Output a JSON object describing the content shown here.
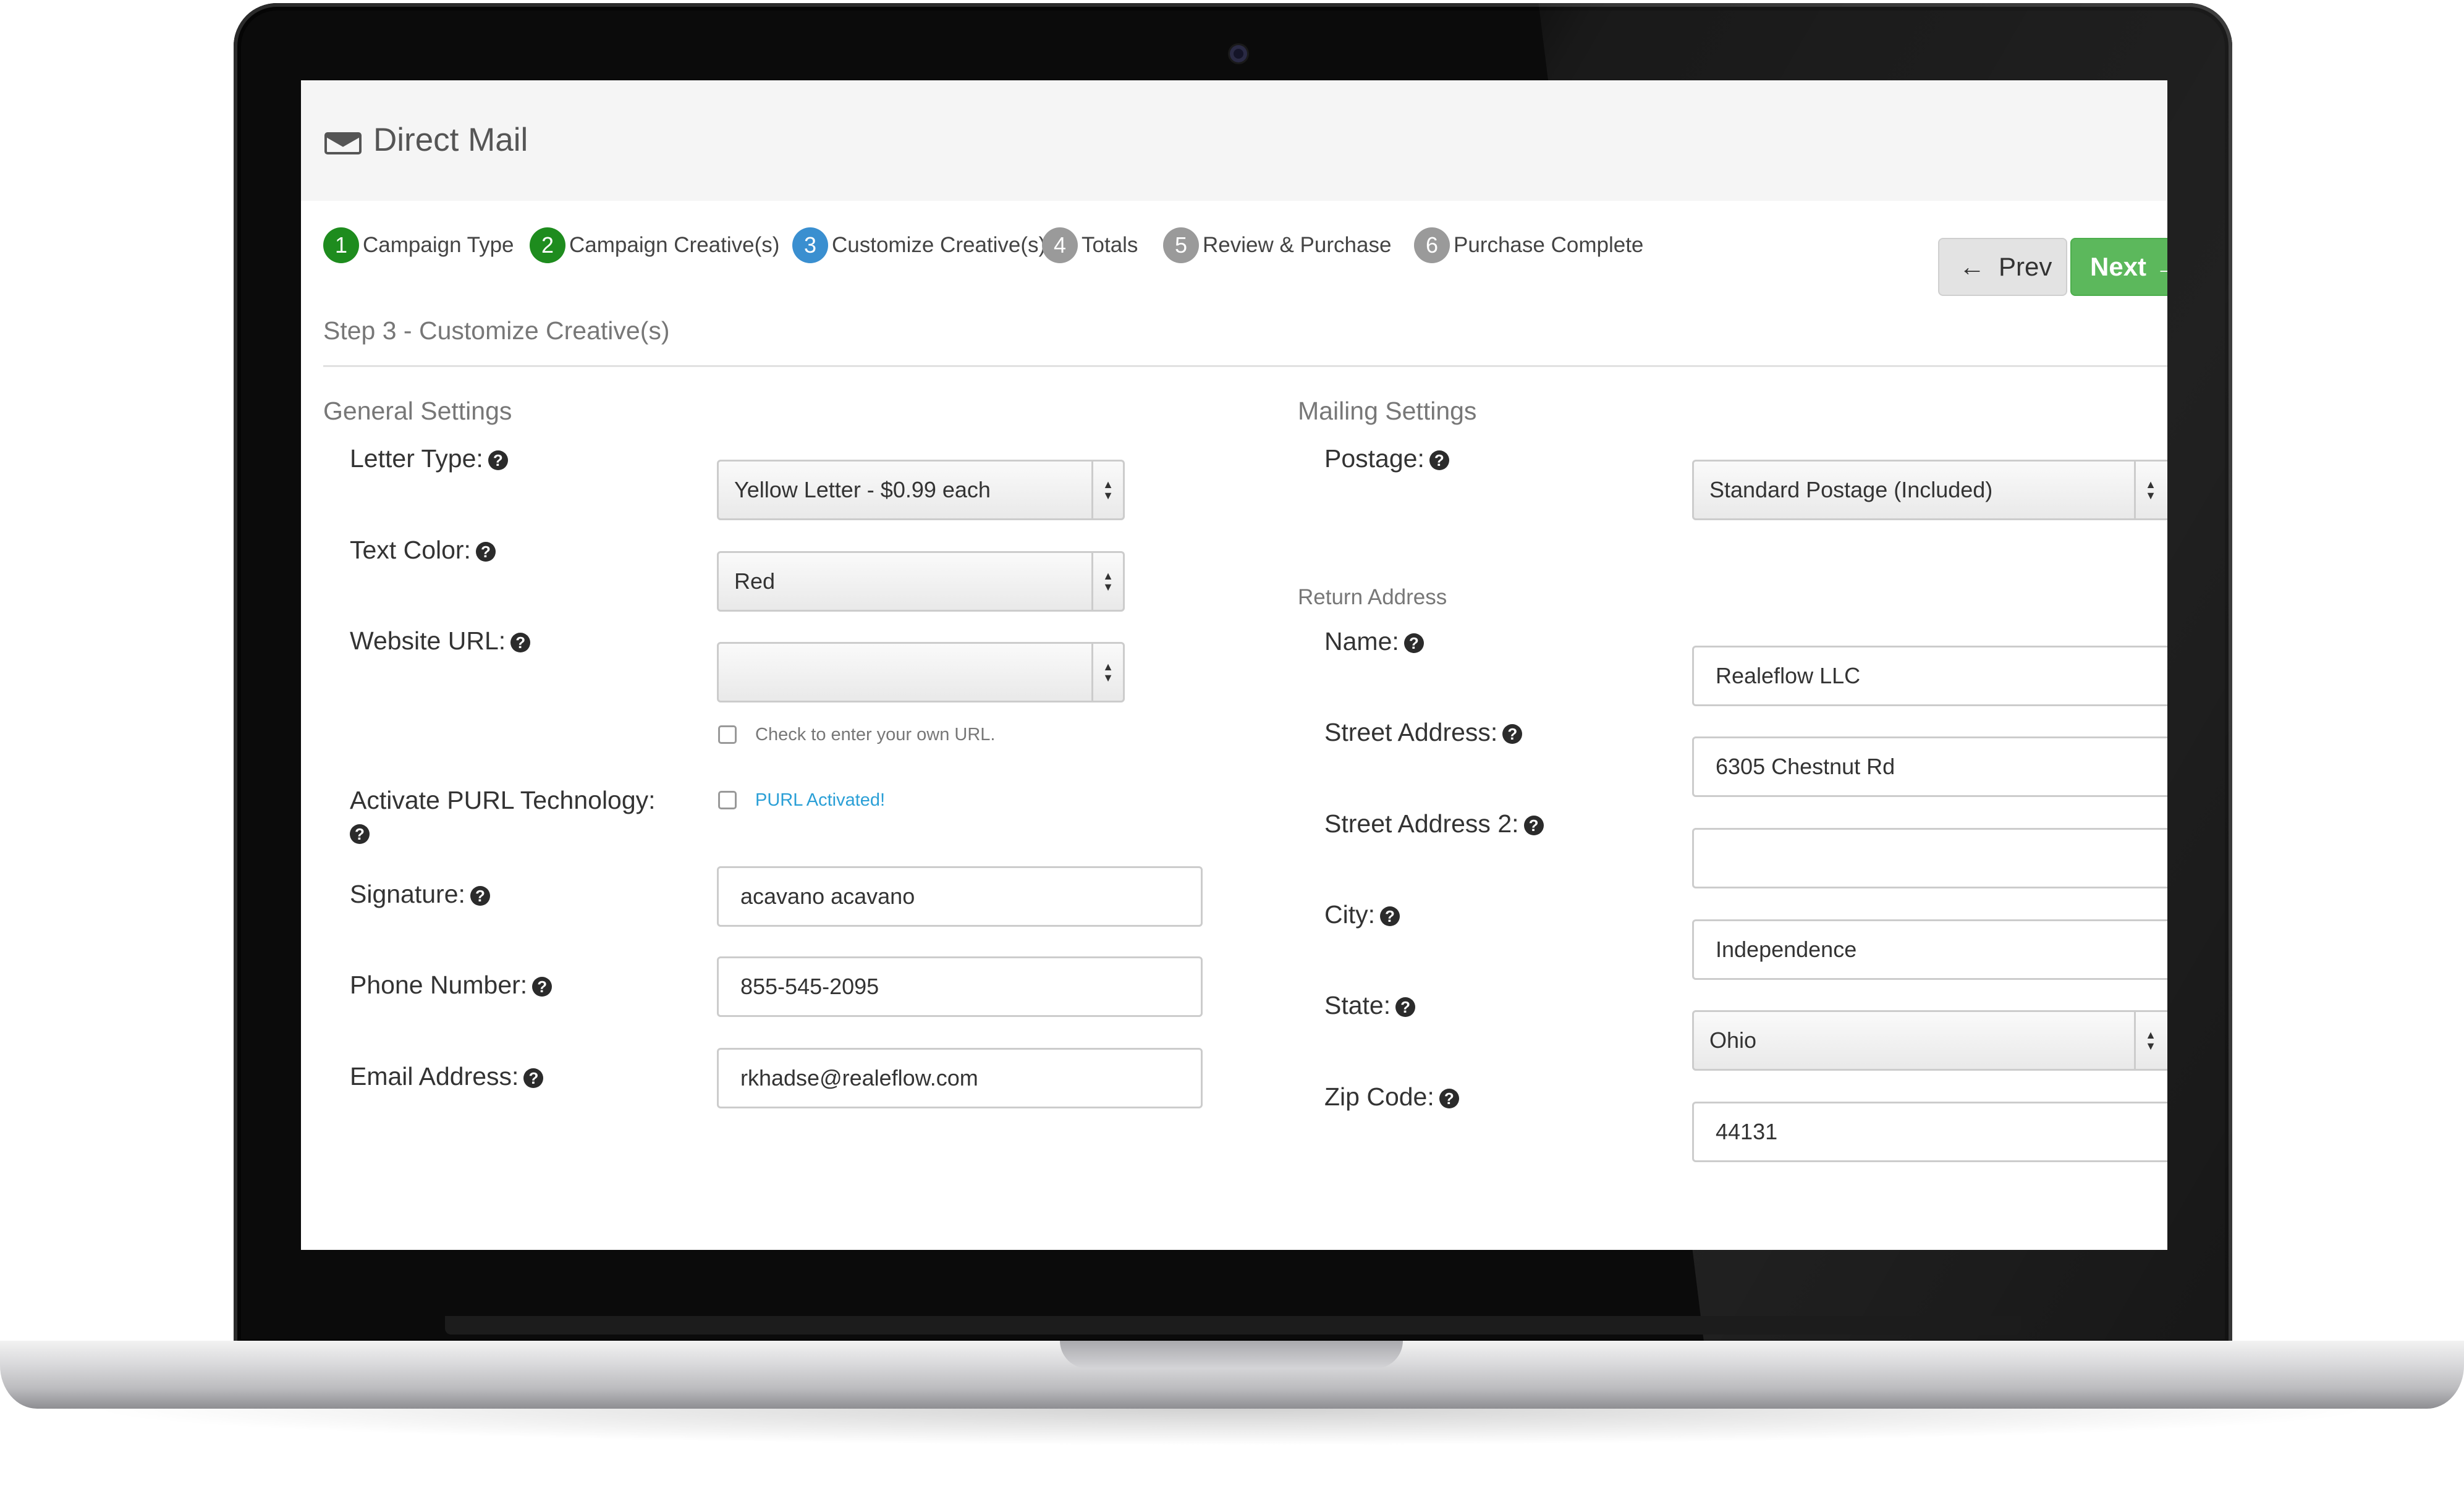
{
  "app": {
    "title": "Direct Mail"
  },
  "steps": [
    {
      "num": "1",
      "label": "Campaign Type",
      "state": "complete",
      "color": "#1e8c1e"
    },
    {
      "num": "2",
      "label": "Campaign Creative(s)",
      "state": "complete",
      "color": "#1e8c1e"
    },
    {
      "num": "3",
      "label": "Customize Creative(s)",
      "state": "current",
      "color": "#3a8fd0"
    },
    {
      "num": "4",
      "label": "Totals",
      "state": "upcoming",
      "color": "#9a9a9a"
    },
    {
      "num": "5",
      "label": "Review & Purchase",
      "state": "upcoming",
      "color": "#9a9a9a"
    },
    {
      "num": "6",
      "label": "Purchase Complete",
      "state": "upcoming",
      "color": "#9a9a9a"
    }
  ],
  "nav": {
    "prev_label": "Prev",
    "next_label": "Next"
  },
  "page": {
    "step_heading": "Step 3 - Customize Creative(s)"
  },
  "general": {
    "heading": "General Settings",
    "letter_type": {
      "label": "Letter Type:",
      "value": "Yellow Letter - $0.99 each"
    },
    "text_color": {
      "label": "Text Color:",
      "value": "Red"
    },
    "website_url": {
      "label": "Website URL:",
      "value": "",
      "own_url_note": "Check to enter your own URL."
    },
    "purl": {
      "label": "Activate PURL Technology:",
      "status": "PURL Activated!"
    },
    "signature": {
      "label": "Signature:",
      "value": "acavano acavano"
    },
    "phone": {
      "label": "Phone Number:",
      "value": "855-545-2095"
    },
    "email": {
      "label": "Email Address:",
      "value": "rkhadse@realeflow.com"
    }
  },
  "mailing": {
    "heading": "Mailing Settings",
    "postage": {
      "label": "Postage:",
      "value": "Standard Postage (Included)"
    },
    "return_heading": "Return Address",
    "name": {
      "label": "Name:",
      "value": "Realeflow LLC"
    },
    "street": {
      "label": "Street Address:",
      "value": "6305 Chestnut Rd"
    },
    "street2": {
      "label": "Street Address 2:",
      "value": ""
    },
    "city": {
      "label": "City:",
      "value": "Independence"
    },
    "state": {
      "label": "State:",
      "value": "Ohio"
    },
    "zip": {
      "label": "Zip Code:",
      "value": "44131"
    }
  },
  "icons": {
    "help": "question-circle-icon",
    "mail": "envelope-icon",
    "prev": "arrow-left-icon",
    "next": "arrow-right-icon"
  }
}
